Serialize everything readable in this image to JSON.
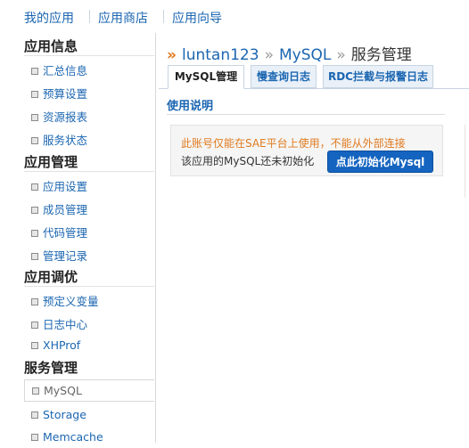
{
  "top_nav": [
    "我的应用",
    "应用商店",
    "应用向导"
  ],
  "sidebar": {
    "sections": [
      {
        "title": "应用信息",
        "items": [
          "汇总信息",
          "预算设置",
          "资源报表",
          "服务状态"
        ]
      },
      {
        "title": "应用管理",
        "items": [
          "应用设置",
          "成员管理",
          "代码管理",
          "管理记录"
        ]
      },
      {
        "title": "应用调优",
        "items": [
          "预定义变量",
          "日志中心",
          "XHProf"
        ]
      },
      {
        "title": "服务管理",
        "items": [
          "MySQL",
          "Storage",
          "Memcache"
        ]
      }
    ],
    "active_item": "MySQL"
  },
  "breadcrumb": {
    "app": "luntan123",
    "service": "MySQL",
    "page": "服务管理",
    "separator": "»"
  },
  "tabs": [
    "MySQL管理",
    "慢查询日志",
    "RDC拦截与报警日志"
  ],
  "active_tab": "MySQL管理",
  "section": {
    "title": "使用说明",
    "warning": "此账号仅能在SAE平台上使用，不能从外部连接",
    "info": "该应用的MySQL还未初始化",
    "button": "点此初始化Mysql"
  },
  "colors": {
    "link": "#1b66b1",
    "warning": "#e07a1f",
    "button": "#1464c0"
  }
}
